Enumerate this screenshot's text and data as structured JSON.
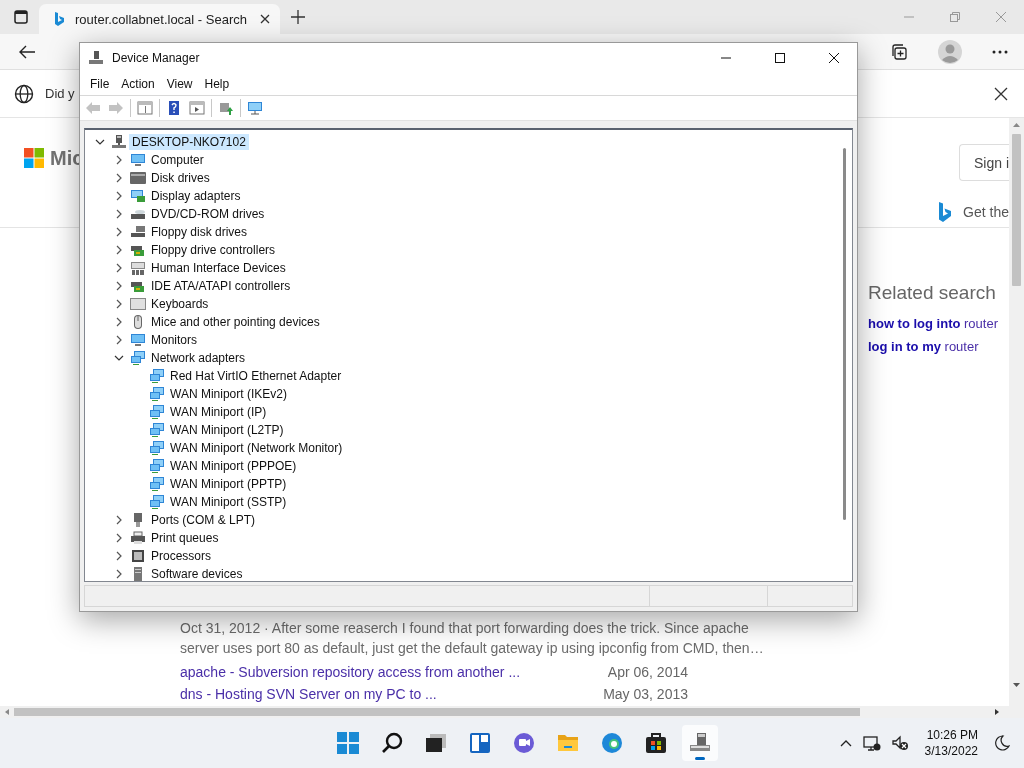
{
  "browser": {
    "tab": {
      "title": "router.collabnet.local - Search",
      "selected": true
    },
    "infobar": {
      "text": "Did y"
    },
    "header": {
      "logo_text": "Mic",
      "sign_in": "Sign i",
      "promo": "Get the"
    },
    "related": {
      "title": "Related search",
      "links": [
        "**how to log into** router",
        "**log in to my** router"
      ]
    },
    "results": [
      {
        "kind": "snippet",
        "text": "Oct 31, 2012 · After some reaserch I found that port forwarding does the trick. Since apache server uses port 80 as default, just get the default gateway ip using ipconfig from CMD, then…"
      },
      {
        "kind": "link",
        "title": "apache - Subversion repository access from another ...",
        "date": "Apr 06, 2014"
      },
      {
        "kind": "link",
        "title": "dns - Hosting SVN Server on my PC to ...",
        "date": "May 03, 2013"
      }
    ]
  },
  "device_manager": {
    "title": "Device Manager",
    "menu": [
      "File",
      "Action",
      "View",
      "Help"
    ],
    "toolbar": [
      {
        "buttons": [
          {
            "kind": "back",
            "disabled": true
          },
          {
            "kind": "forward",
            "disabled": true
          }
        ]
      },
      {
        "buttons": [
          {
            "kind": "view",
            "disabled": false
          }
        ]
      },
      {
        "buttons": [
          {
            "kind": "help",
            "disabled": false
          },
          {
            "kind": "console",
            "disabled": false
          }
        ]
      },
      {
        "buttons": [
          {
            "kind": "update",
            "disabled": false
          }
        ]
      },
      {
        "buttons": [
          {
            "kind": "scan",
            "disabled": false
          }
        ]
      }
    ],
    "tree": {
      "label": "DESKTOP-NKO7102",
      "kind": "root",
      "expanded": true,
      "selected": true,
      "children": [
        {
          "label": "Computer",
          "kind": "monitor",
          "expanded": false,
          "selected": false
        },
        {
          "label": "Disk drives",
          "kind": "disk",
          "expanded": false,
          "selected": false
        },
        {
          "label": "Display adapters",
          "kind": "card",
          "expanded": false,
          "selected": false
        },
        {
          "label": "DVD/CD-ROM drives",
          "kind": "dvd",
          "expanded": false,
          "selected": false
        },
        {
          "label": "Floppy disk drives",
          "kind": "floppy",
          "expanded": false,
          "selected": false
        },
        {
          "label": "Floppy drive controllers",
          "kind": "controller",
          "expanded": false,
          "selected": false
        },
        {
          "label": "Human Interface Devices",
          "kind": "hid",
          "expanded": false,
          "selected": false
        },
        {
          "label": "IDE ATA/ATAPI controllers",
          "kind": "controller",
          "expanded": false,
          "selected": false
        },
        {
          "label": "Keyboards",
          "kind": "keyboard",
          "expanded": false,
          "selected": false
        },
        {
          "label": "Mice and other pointing devices",
          "kind": "mouse",
          "expanded": false,
          "selected": false
        },
        {
          "label": "Monitors",
          "kind": "monitor",
          "expanded": false,
          "selected": false
        },
        {
          "label": "Network adapters",
          "kind": "network",
          "expanded": true,
          "selected": false,
          "children": [
            {
              "label": "Red Hat VirtIO Ethernet Adapter",
              "kind": "network",
              "selected": false
            },
            {
              "label": "WAN Miniport (IKEv2)",
              "kind": "network",
              "selected": false
            },
            {
              "label": "WAN Miniport (IP)",
              "kind": "network",
              "selected": false
            },
            {
              "label": "WAN Miniport (L2TP)",
              "kind": "network",
              "selected": false
            },
            {
              "label": "WAN Miniport (Network Monitor)",
              "kind": "network",
              "selected": false
            },
            {
              "label": "WAN Miniport (PPPOE)",
              "kind": "network",
              "selected": false
            },
            {
              "label": "WAN Miniport (PPTP)",
              "kind": "network",
              "selected": false
            },
            {
              "label": "WAN Miniport (SSTP)",
              "kind": "network",
              "selected": false
            }
          ]
        },
        {
          "label": "Ports (COM & LPT)",
          "kind": "port",
          "expanded": false,
          "selected": false
        },
        {
          "label": "Print queues",
          "kind": "printer",
          "expanded": false,
          "selected": false
        },
        {
          "label": "Processors",
          "kind": "chip",
          "expanded": false,
          "selected": false
        },
        {
          "label": "Software devices",
          "kind": "software",
          "expanded": false,
          "selected": false
        }
      ]
    }
  },
  "taskbar": {
    "apps": [
      {
        "kind": "start",
        "active": false
      },
      {
        "kind": "search",
        "active": false
      },
      {
        "kind": "taskview",
        "active": false
      },
      {
        "kind": "widgets",
        "active": false
      },
      {
        "kind": "chat",
        "active": false
      },
      {
        "kind": "explorer",
        "active": false
      },
      {
        "kind": "edge",
        "active": false
      },
      {
        "kind": "store",
        "active": false
      },
      {
        "kind": "devmgr",
        "active": true
      }
    ],
    "time": "10:26 PM",
    "date": "3/13/2022"
  }
}
